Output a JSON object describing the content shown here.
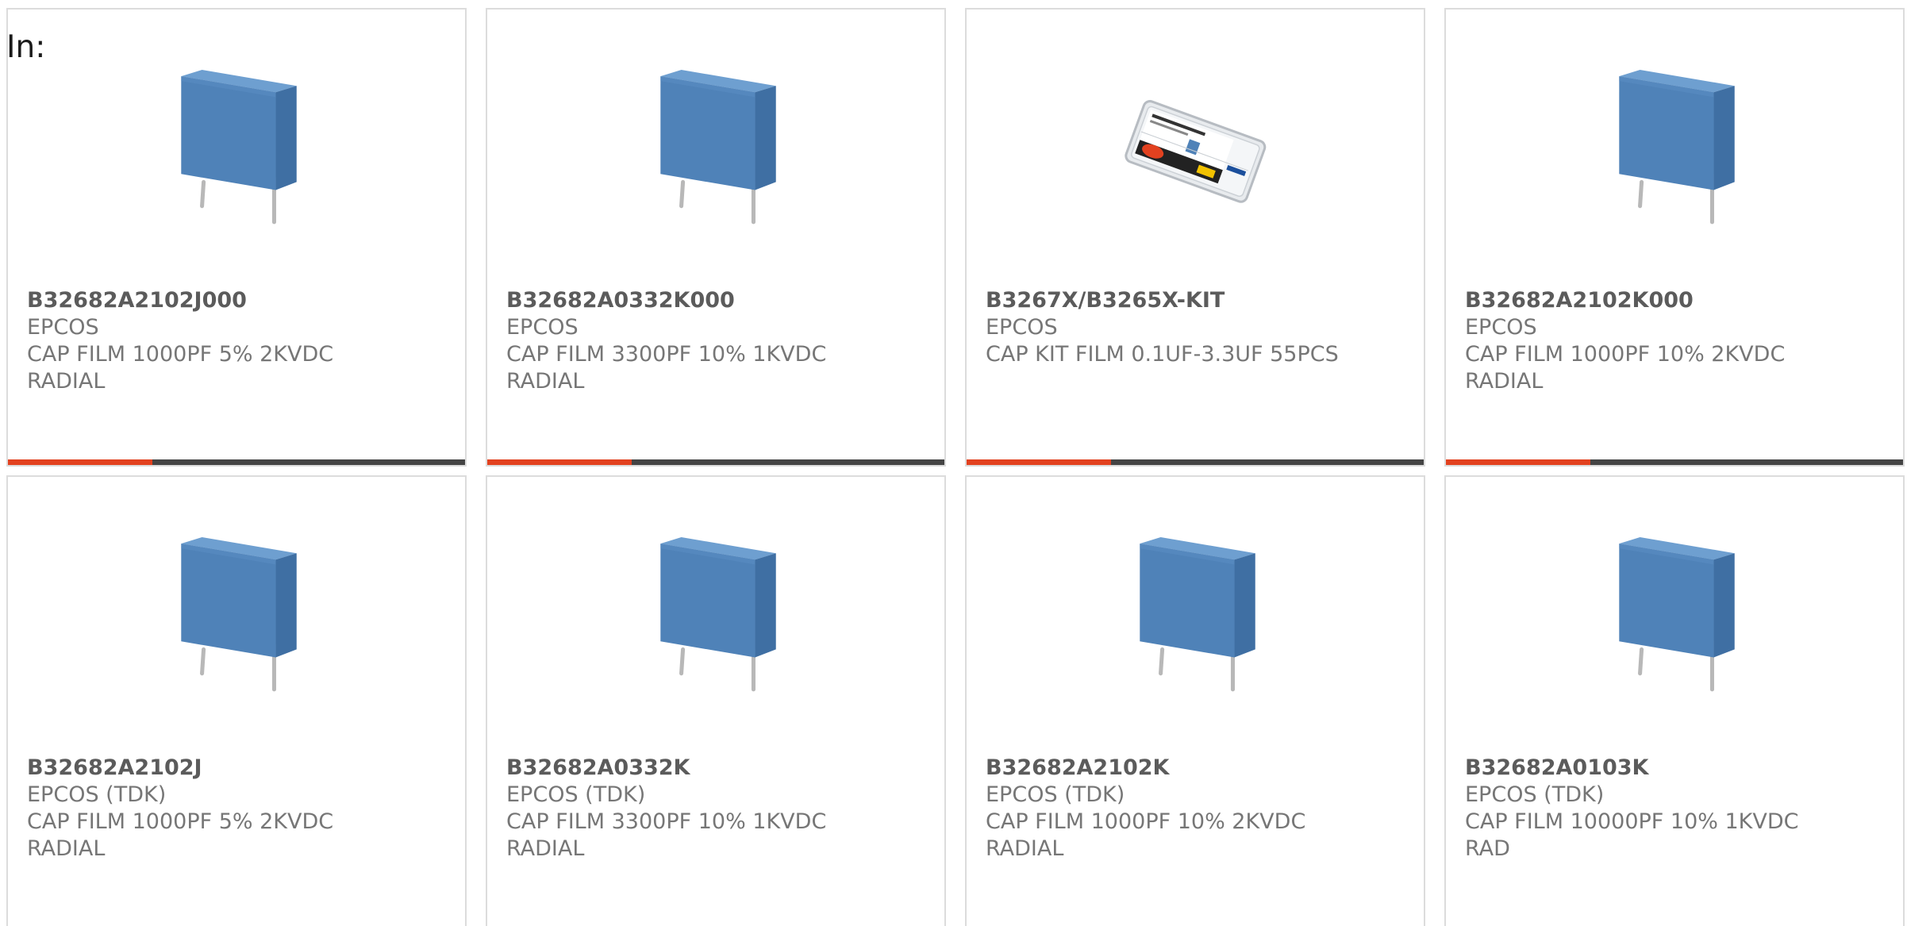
{
  "header": {
    "label": "In:"
  },
  "colors": {
    "accent": "#e2411f",
    "bar": "#444444",
    "border": "#dcdcdc",
    "text": "#767676",
    "capacitor": "#4f82b8"
  },
  "products": [
    {
      "part": "B32682A2102J000",
      "maker": "EPCOS",
      "desc1": "CAP FILM 1000PF 5% 2KVDC",
      "desc2": "RADIAL",
      "image": "film-capacitor"
    },
    {
      "part": "B32682A0332K000",
      "maker": "EPCOS",
      "desc1": "CAP FILM 3300PF 10% 1KVDC",
      "desc2": "RADIAL",
      "image": "film-capacitor"
    },
    {
      "part": "B3267X/B3265X-KIT",
      "maker": "EPCOS",
      "desc1": "CAP KIT FILM 0.1UF-3.3UF 55PCS",
      "desc2": "",
      "image": "capacitor-kit-box"
    },
    {
      "part": "B32682A2102K000",
      "maker": "EPCOS",
      "desc1": "CAP FILM 1000PF 10% 2KVDC",
      "desc2": "RADIAL",
      "image": "film-capacitor"
    },
    {
      "part": "B32682A2102J",
      "maker": "EPCOS (TDK)",
      "desc1": "CAP FILM 1000PF 5% 2KVDC",
      "desc2": "RADIAL",
      "image": "film-capacitor"
    },
    {
      "part": "B32682A0332K",
      "maker": "EPCOS (TDK)",
      "desc1": "CAP FILM 3300PF 10% 1KVDC",
      "desc2": "RADIAL",
      "image": "film-capacitor"
    },
    {
      "part": "B32682A2102K",
      "maker": "EPCOS (TDK)",
      "desc1": "CAP FILM 1000PF 10% 2KVDC",
      "desc2": "RADIAL",
      "image": "film-capacitor"
    },
    {
      "part": "B32682A0103K",
      "maker": "EPCOS (TDK)",
      "desc1": "CAP FILM 10000PF 10% 1KVDC",
      "desc2": "RAD",
      "image": "film-capacitor"
    }
  ]
}
